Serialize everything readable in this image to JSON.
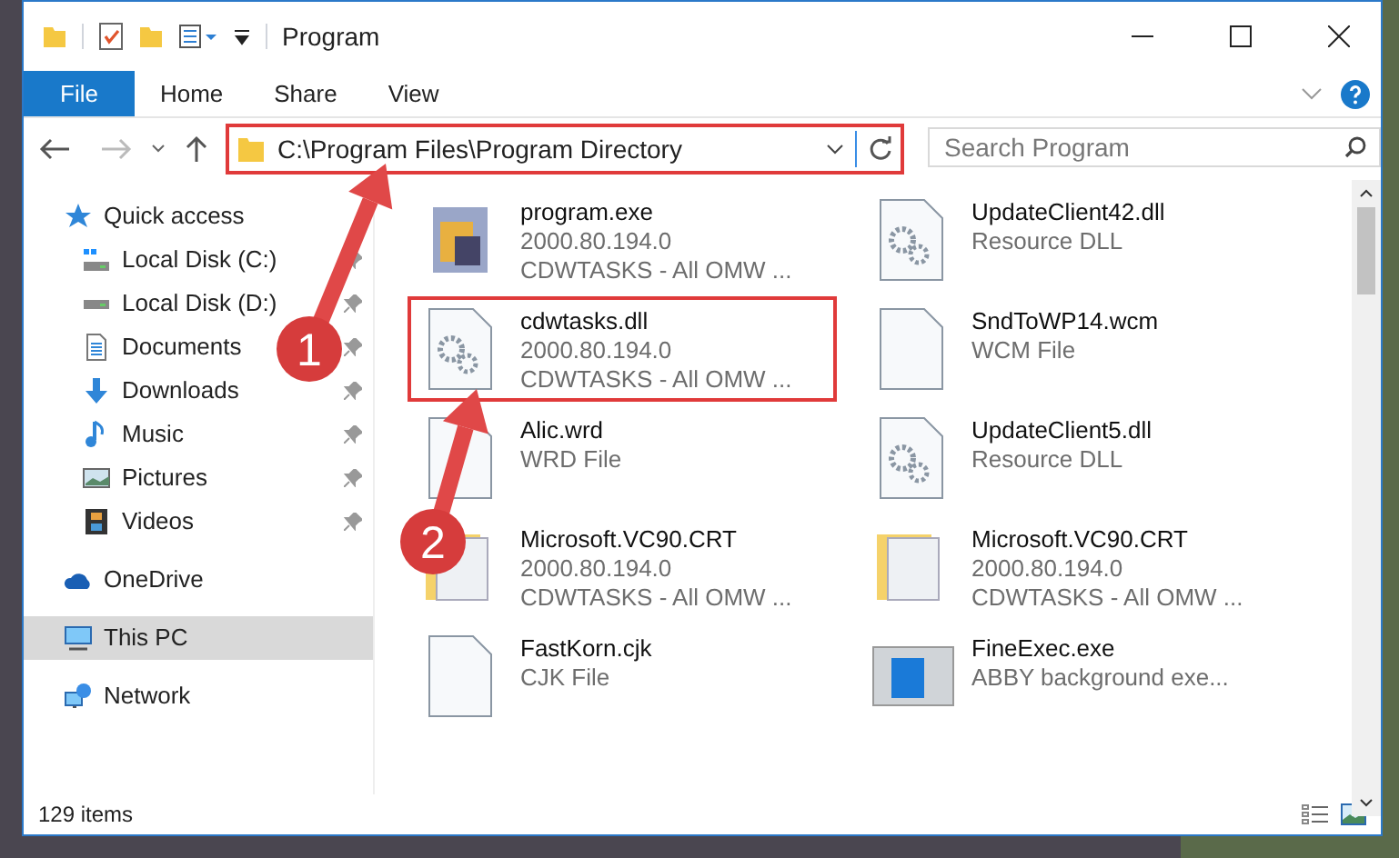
{
  "window": {
    "title": "Program"
  },
  "ribbon_tabs": [
    {
      "label": "File",
      "selected": true
    },
    {
      "label": "Home",
      "selected": false
    },
    {
      "label": "Share",
      "selected": false
    },
    {
      "label": "View",
      "selected": false
    }
  ],
  "address_bar": {
    "path": "C:\\Program Files\\Program Directory",
    "highlighted": true
  },
  "search": {
    "placeholder": "Search Program"
  },
  "sidebar": {
    "items": [
      {
        "label": "Quick access",
        "selected": false,
        "children": [
          {
            "label": "Local Disk (C:)",
            "pinned": true
          },
          {
            "label": "Local Disk (D:)",
            "pinned": true
          },
          {
            "label": "Documents",
            "pinned": true
          },
          {
            "label": "Downloads",
            "pinned": true
          },
          {
            "label": "Music",
            "pinned": true
          },
          {
            "label": "Pictures",
            "pinned": true
          },
          {
            "label": "Videos",
            "pinned": true
          }
        ]
      },
      {
        "label": "OneDrive",
        "selected": false
      },
      {
        "label": "This PC",
        "selected": true
      },
      {
        "label": "Network",
        "selected": false
      }
    ]
  },
  "files": [
    {
      "kind": "exe",
      "name": "program.exe",
      "details": [
        "2000.80.194.0",
        "CDWTASKS - All OMW ..."
      ],
      "highlighted": false
    },
    {
      "kind": "dll",
      "name": "UpdateClient42.dll",
      "details": [
        "Resource DLL"
      ],
      "highlighted": false
    },
    {
      "kind": "dll",
      "name": "cdwtasks.dll",
      "details": [
        "2000.80.194.0",
        "CDWTASKS - All OMW ..."
      ],
      "highlighted": true
    },
    {
      "kind": "file",
      "name": "SndToWP14.wcm",
      "details": [
        "WCM File"
      ],
      "highlighted": false
    },
    {
      "kind": "file",
      "name": "Alic.wrd",
      "details": [
        "WRD File"
      ],
      "highlighted": false
    },
    {
      "kind": "dll",
      "name": "UpdateClient5.dll",
      "details": [
        "Resource DLL"
      ],
      "highlighted": false
    },
    {
      "kind": "folder",
      "name": "Microsoft.VC90.CRT",
      "details": [
        "2000.80.194.0",
        "CDWTASKS - All OMW ..."
      ],
      "highlighted": false
    },
    {
      "kind": "folder",
      "name": "Microsoft.VC90.CRT",
      "details": [
        "2000.80.194.0",
        "CDWTASKS - All OMW ..."
      ],
      "highlighted": false
    },
    {
      "kind": "file",
      "name": "FastKorn.cjk",
      "details": [
        "CJK File"
      ],
      "highlighted": false
    },
    {
      "kind": "app",
      "name": "FineExec.exe",
      "details": [
        "ABBY background exe..."
      ],
      "highlighted": false
    }
  ],
  "status_bar": {
    "item_count": "129 items"
  },
  "annotations": [
    {
      "label": "1"
    },
    {
      "label": "2"
    }
  ]
}
